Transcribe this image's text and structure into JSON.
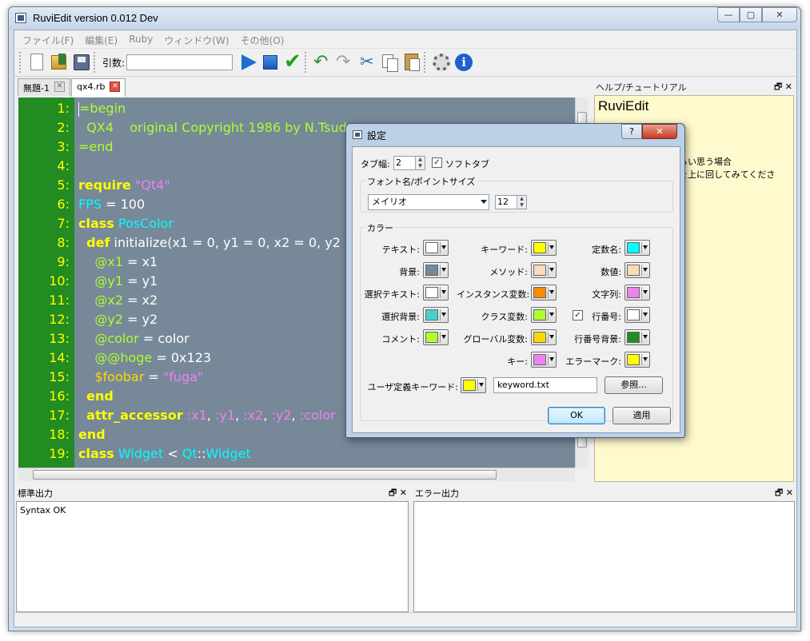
{
  "app": {
    "title": "RuviEdit version 0.012 Dev"
  },
  "window_buttons": {
    "minimize": "—",
    "maximize": "▢",
    "close": "✕"
  },
  "menu": [
    "ファイル(F)",
    "編集(E)",
    "Ruby",
    "ウィンドウ(W)",
    "その他(O)"
  ],
  "toolbar": {
    "arg_label": "引数:",
    "arg_value": ""
  },
  "tabs": [
    {
      "label": "無題-1"
    },
    {
      "label": "qx4.rb"
    }
  ],
  "editor": {
    "colors": {
      "gutter": "#228b22",
      "background": "#778899",
      "line_number": "#ffff00"
    },
    "lines": [
      {
        "n": "1:",
        "tokens": [
          [
            "cursor",
            ""
          ],
          [
            "cm",
            "=begin"
          ]
        ]
      },
      {
        "n": "2:",
        "tokens": [
          [
            "cm",
            "  QX4    original Copyright 1986 by N.Tsuda"
          ]
        ]
      },
      {
        "n": "3:",
        "tokens": [
          [
            "cm",
            "=end"
          ]
        ]
      },
      {
        "n": "4:",
        "tokens": []
      },
      {
        "n": "5:",
        "tokens": [
          [
            "kw",
            "require"
          ],
          [
            "pl",
            " "
          ],
          [
            "st",
            "\"Qt4\""
          ]
        ]
      },
      {
        "n": "6:",
        "tokens": [
          [
            "cn",
            "FPS"
          ],
          [
            "pl",
            " = 100"
          ]
        ]
      },
      {
        "n": "7:",
        "tokens": [
          [
            "kw",
            "class"
          ],
          [
            "pl",
            " "
          ],
          [
            "cn",
            "PosColor"
          ]
        ]
      },
      {
        "n": "8:",
        "tokens": [
          [
            "pl",
            "  "
          ],
          [
            "kw",
            "def"
          ],
          [
            "pl",
            " initialize(x1 = 0, y1 = 0, x2 = 0, y2 = 0, color = 0)"
          ]
        ]
      },
      {
        "n": "9:",
        "tokens": [
          [
            "pl",
            "    "
          ],
          [
            "iv",
            "@x1"
          ],
          [
            "pl",
            " = x1"
          ]
        ]
      },
      {
        "n": "10:",
        "tokens": [
          [
            "pl",
            "    "
          ],
          [
            "iv",
            "@y1"
          ],
          [
            "pl",
            " = y1"
          ]
        ]
      },
      {
        "n": "11:",
        "tokens": [
          [
            "pl",
            "    "
          ],
          [
            "iv",
            "@x2"
          ],
          [
            "pl",
            " = x2"
          ]
        ]
      },
      {
        "n": "12:",
        "tokens": [
          [
            "pl",
            "    "
          ],
          [
            "iv",
            "@y2"
          ],
          [
            "pl",
            " = y2"
          ]
        ]
      },
      {
        "n": "13:",
        "tokens": [
          [
            "pl",
            "    "
          ],
          [
            "iv",
            "@color"
          ],
          [
            "pl",
            " = color"
          ]
        ]
      },
      {
        "n": "14:",
        "tokens": [
          [
            "pl",
            "    "
          ],
          [
            "iv",
            "@@hoge"
          ],
          [
            "pl",
            " = 0x123"
          ]
        ]
      },
      {
        "n": "15:",
        "tokens": [
          [
            "pl",
            "    "
          ],
          [
            "gv",
            "$foobar"
          ],
          [
            "pl",
            " = "
          ],
          [
            "st",
            "\"fuga\""
          ]
        ]
      },
      {
        "n": "16:",
        "tokens": [
          [
            "pl",
            "  "
          ],
          [
            "kw",
            "end"
          ]
        ]
      },
      {
        "n": "17:",
        "tokens": [
          [
            "pl",
            "  "
          ],
          [
            "kw",
            "attr_accessor"
          ],
          [
            "pl",
            " "
          ],
          [
            "sy",
            ":x1"
          ],
          [
            "pl",
            ", "
          ],
          [
            "sy",
            ":y1"
          ],
          [
            "pl",
            ", "
          ],
          [
            "sy",
            ":x2"
          ],
          [
            "pl",
            ", "
          ],
          [
            "sy",
            ":y2"
          ],
          [
            "pl",
            ", "
          ],
          [
            "sy",
            ":color"
          ]
        ]
      },
      {
        "n": "18:",
        "tokens": [
          [
            "kw",
            "end"
          ]
        ]
      },
      {
        "n": "19:",
        "tokens": [
          [
            "kw",
            "class"
          ],
          [
            "pl",
            " "
          ],
          [
            "cn",
            "Widget"
          ],
          [
            "pl",
            " < "
          ],
          [
            "cn",
            "Qt"
          ],
          [
            "pl",
            "::"
          ],
          [
            "cn",
            "Widget"
          ]
        ]
      }
    ]
  },
  "help_panel": {
    "title": "ヘルプ/チュートリアル",
    "heading": "RuviEdit",
    "lines": [
      "読みづらい思う場合",
      "イールを上に回してみてくださ"
    ],
    "panel_buttons": "🗗 ✕"
  },
  "stdout_panel": {
    "title": "標準出力",
    "content": "Syntax OK"
  },
  "stderr_panel": {
    "title": "エラー出力",
    "content": ""
  },
  "dialog": {
    "title": "設定",
    "help_btn": "?",
    "close_btn": "✕",
    "tab_width_label": "タブ幅:",
    "tab_width": "2",
    "soft_tab_label": "ソフトタブ",
    "soft_tab_checked": true,
    "font_group_label": "フォント名/ポイントサイズ",
    "font_name": "メイリオ",
    "font_size": "12",
    "color_group_label": "カラー",
    "colors": [
      [
        {
          "label": "テキスト:",
          "color": "#ffffff"
        },
        {
          "label": "キーワード:",
          "color": "#ffff00"
        },
        {
          "label": "定数名:",
          "color": "#00ffff"
        }
      ],
      [
        {
          "label": "背景:",
          "color": "#778899"
        },
        {
          "label": "メソッド:",
          "color": "#ffdab9"
        },
        {
          "label": "数値:",
          "color": "#ffdab9"
        }
      ],
      [
        {
          "label": "選択テキスト:",
          "color": "#ffffff"
        },
        {
          "label": "インスタンス変数:",
          "color": "#ff8c00"
        },
        {
          "label": "文字列:",
          "color": "#ee82ee"
        }
      ],
      [
        {
          "label": "選択背景:",
          "color": "#48d1cc"
        },
        {
          "label": "クラス変数:",
          "color": "#adff2f"
        },
        {
          "label": "行番号:",
          "color": "#ffffff",
          "checkbox": true
        }
      ],
      [
        {
          "label": "コメント:",
          "color": "#adff2f"
        },
        {
          "label": "グローバル変数:",
          "color": "#ffd700"
        },
        {
          "label": "行番号背景:",
          "color": "#228b22"
        }
      ],
      [
        null,
        {
          "label": "キー:",
          "color": "#ee82ee"
        },
        {
          "label": "エラーマーク:",
          "color": "#ffff00"
        }
      ]
    ],
    "user_kw_label": "ユーザ定義キーワード:",
    "user_kw_color": "#ffff00",
    "keyword_file": "keyword.txt",
    "browse_label": "参照...",
    "ok_label": "OK",
    "apply_label": "適用"
  }
}
